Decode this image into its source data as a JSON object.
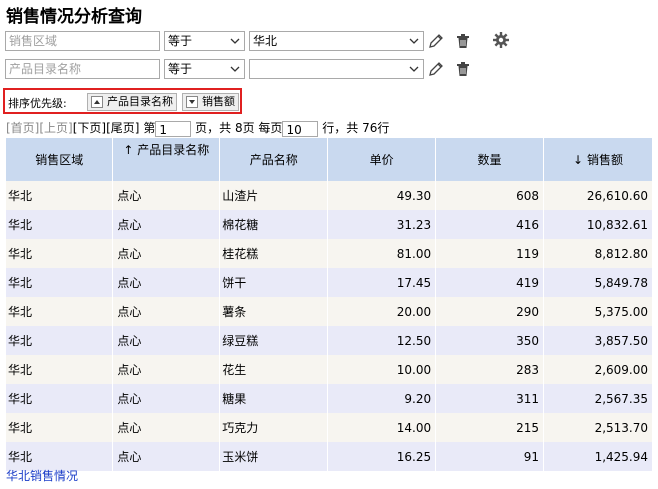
{
  "title": "销售情况分析查询",
  "filters": [
    {
      "field_placeholder": "销售区域",
      "operator": "等于",
      "value": "华北"
    },
    {
      "field_placeholder": "产品目录名称",
      "operator": "等于",
      "value": ""
    }
  ],
  "sort": {
    "label": "排序优先级:",
    "items": [
      "产品目录名称",
      "销售额"
    ]
  },
  "pager": {
    "first": "[首页]",
    "prev": "[上页]",
    "next": "[下页]",
    "last": "[尾页]",
    "page_prefix": "第",
    "page": "1",
    "page_suffix": "页，共 8页 每页",
    "page_size": "10",
    "size_suffix": "行，共 76行"
  },
  "table": {
    "headers": [
      "销售区域",
      "产品目录名称",
      "产品名称",
      "单价",
      "数量",
      "销售额"
    ],
    "sort_marks": {
      "产品目录名称": "↑",
      "销售额": "↓"
    },
    "rows": [
      [
        "华北",
        "点心",
        "山渣片",
        "49.30",
        "608",
        "26,610.60"
      ],
      [
        "华北",
        "点心",
        "棉花糖",
        "31.23",
        "416",
        "10,832.61"
      ],
      [
        "华北",
        "点心",
        "桂花糕",
        "81.00",
        "119",
        "8,812.80"
      ],
      [
        "华北",
        "点心",
        "饼干",
        "17.45",
        "419",
        "5,849.78"
      ],
      [
        "华北",
        "点心",
        "薯条",
        "20.00",
        "290",
        "5,375.00"
      ],
      [
        "华北",
        "点心",
        "绿豆糕",
        "12.50",
        "350",
        "3,857.50"
      ],
      [
        "华北",
        "点心",
        "花生",
        "10.00",
        "283",
        "2,609.00"
      ],
      [
        "华北",
        "点心",
        "糖果",
        "9.20",
        "311",
        "2,567.35"
      ],
      [
        "华北",
        "点心",
        "巧克力",
        "14.00",
        "215",
        "2,513.70"
      ],
      [
        "华北",
        "点心",
        "玉米饼",
        "16.25",
        "91",
        "1,425.94"
      ]
    ]
  },
  "footer_link": "华北销售情况",
  "icons": [
    "pencil-icon",
    "trash-icon",
    "gear-icon",
    "sort-arrow-icon"
  ],
  "colors": {
    "header_bg": "#c9d9ef",
    "row_odd": "#f7f5f0",
    "row_even": "#e9eaf8",
    "highlight_border": "#e02020",
    "link": "#1a3cc8"
  }
}
